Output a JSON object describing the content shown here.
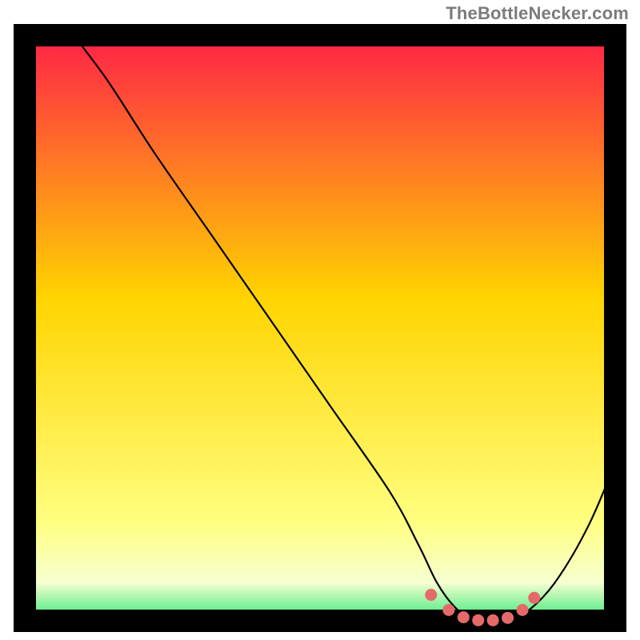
{
  "attribution": "TheBottleNecker.com",
  "colors": {
    "border": "#000000",
    "gradient_top": "#ff1a4a",
    "gradient_mid": "#ffd400",
    "gradient_low": "#ffff80",
    "gradient_band": "#f6ffd0",
    "gradient_bottom": "#00e060",
    "curve": "#000000",
    "dot": "#e46a6a"
  },
  "chart_data": {
    "type": "line",
    "title": "",
    "xlabel": "",
    "ylabel": "",
    "xlim": [
      0,
      100
    ],
    "ylim": [
      0,
      100
    ],
    "series": [
      {
        "name": "bottleneck-curve",
        "x": [
          5,
          12,
          20,
          30,
          40,
          50,
          60,
          65,
          68,
          71,
          74,
          77,
          80,
          83,
          88,
          94,
          100
        ],
        "y": [
          100,
          91,
          79,
          65,
          51,
          37,
          23,
          14,
          8,
          4,
          2,
          2,
          2,
          3,
          8,
          18,
          32
        ]
      }
    ],
    "dots": {
      "name": "optimal-range",
      "x": [
        67,
        70,
        72.5,
        75,
        77.5,
        80,
        82.5,
        84.5
      ],
      "y": [
        6,
        3.5,
        2.3,
        1.8,
        1.8,
        2.2,
        3.5,
        5.5
      ]
    }
  }
}
